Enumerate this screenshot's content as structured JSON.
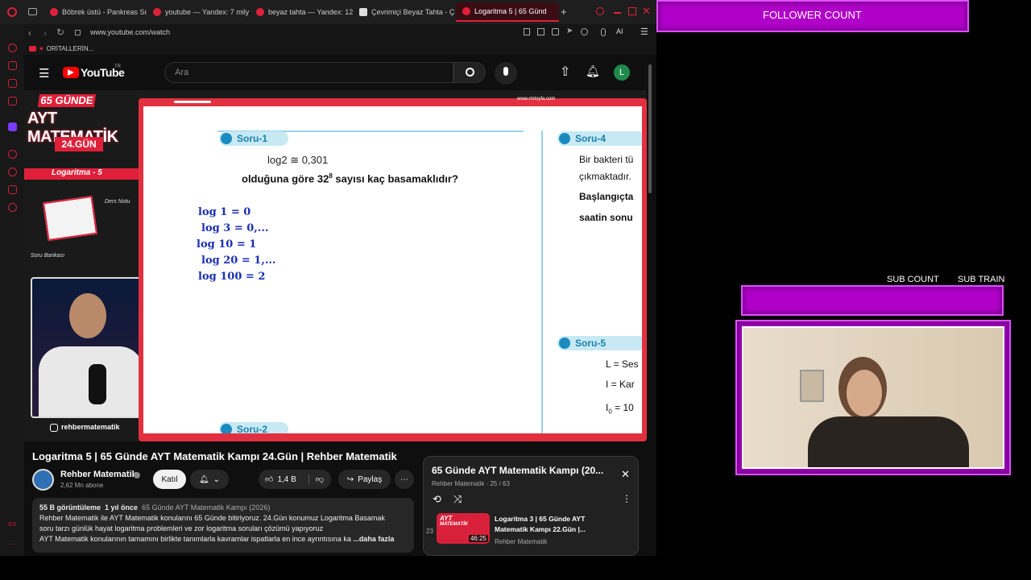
{
  "tabs": [
    {
      "label": "Böbrek üstü - Pankreas Sc",
      "active": false
    },
    {
      "label": "youtube — Yandex: 7 mily",
      "active": false
    },
    {
      "label": "beyaz tahta — Yandex: 12",
      "active": false
    },
    {
      "label": "Çevrimiçi Beyaz Tahta - Ç",
      "active": false
    },
    {
      "label": "Logaritma 5 | 65 Günd",
      "active": true
    }
  ],
  "tab_plus": "+",
  "address": "www.youtube.com/watch",
  "address_ai": "AI",
  "bookmark": "ORİTALLERİN...",
  "yt": {
    "logo": "YouTube",
    "region": "TR",
    "search_placeholder": "Ara",
    "avatar_letter": "L"
  },
  "slide": {
    "banner_top": "65 GÜNDE",
    "banner_main": "AYT MATEMATİK",
    "banner_day": "24.GÜN",
    "topic": "Logaritma - 5",
    "ders_notu": "Ders Notu",
    "soru_bankasi": "Soru Bankası",
    "instagram": "rehbermatematik",
    "site": "www.rmtoyfa.com",
    "soru1": "Soru-1",
    "soru2": "Soru-2",
    "soru4": "Soru-4",
    "soru5": "Soru-5",
    "given": "log2 ≅ 0,301",
    "question_pre": "olduğuna göre 32",
    "question_exp": "8",
    "question_post": " sayısı kaç basamaklıdır?",
    "hand_lines": [
      {
        "left": "log 1",
        "right": "= 0"
      },
      {
        "left": "log 3",
        "right": "= 0,..."
      },
      {
        "left": "log 10",
        "right": "= 1"
      },
      {
        "left": "log 20",
        "right": "= 1,..."
      },
      {
        "left": "log 100",
        "right": "= 2"
      }
    ],
    "s4_line1": "Bir bakteri tü",
    "s4_line2": "çıkmaktadır.",
    "s4_line3": "Başlangıçta",
    "s4_line4": "saatin sonu",
    "s5_line1": "L = Ses",
    "s5_line2": "I = Kar",
    "s5_line3": "I",
    "s5_line3_sub": "0",
    "s5_line3_rest": " = 10"
  },
  "video": {
    "title": "Logaritma 5 | 65 Günde AYT Matematik Kampı 24.Gün | Rehber Matematik",
    "channel": "Rehber Matematik",
    "subs": "2,62 Mn abone",
    "join": "Katıl",
    "likes": "1,4 B",
    "share": "Paylaş",
    "views": "55 B görüntüleme",
    "ago": "1 yıl önce",
    "playlist_link": "65 Günde AYT Matematik Kampı (2026)",
    "desc1": "Rehber Matematik ile AYT Matematik konularını 65 Günde bitiriyoruz. 24.Gün konumuz Logaritma Basamak",
    "desc2": "soru tarzı günlük hayat logaritma problemleri ve zor logaritma soruları çözümü yapıyoruz",
    "desc3": "AYT Matematik konularının tamamını birlikte tanımlarla kavramlar ispatlarla en ince ayrıntısına ka",
    "more": "...daha fazla"
  },
  "playlist": {
    "title": "65 Günde AYT Matematik Kampı (20...",
    "meta": "Rehber Matematik · 25 / 63",
    "item_index": "23",
    "item_title1": "Logaritma 3 | 65 Günde AYT",
    "item_title2": "Matematik Kampı 22.Gün |...",
    "item_channel": "Rehber Matematik",
    "item_duration": "46:25",
    "thumb_text1": "AYT",
    "thumb_text2": "MATEMATİK"
  },
  "overlay": {
    "follower": "FOLLOWER COUNT",
    "sub_count": "SUB COUNT",
    "sub_train": "SUB TRAIN"
  },
  "colors": {
    "accent": "#e0203a",
    "overlay": "#b000c8"
  }
}
